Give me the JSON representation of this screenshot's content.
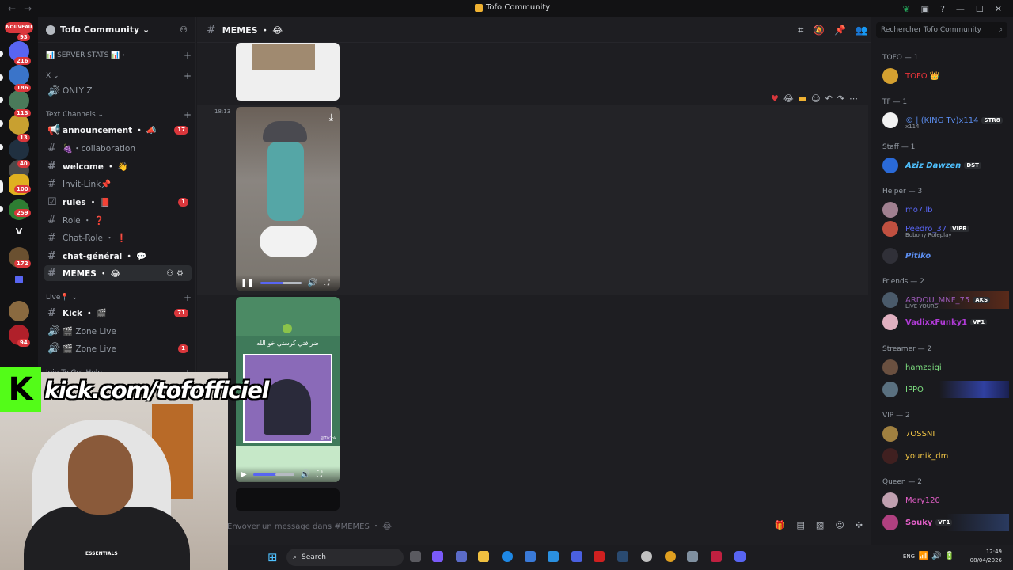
{
  "window": {
    "title": "Tofo Community",
    "back": "←",
    "forward": "→"
  },
  "guilds": {
    "new_label": "NOUVEAU",
    "badges": [
      "93",
      "216",
      "186",
      "113",
      "13",
      "40",
      "100",
      "259",
      "V",
      "172",
      "94"
    ]
  },
  "server": {
    "name": "Tofo Community ⌄"
  },
  "channels": {
    "categories": [
      {
        "label": "📊 SERVER STATS 📊 ›"
      },
      {
        "label": "X ⌄"
      },
      {
        "label": "Text Channels ⌄"
      },
      {
        "label": "Live📍 ⌄"
      },
      {
        "label": "Join To Get Help ⌄"
      }
    ],
    "only_z": "ONLY Z",
    "items": [
      {
        "name": "announcement ・ 📣",
        "badge": "17"
      },
      {
        "name": "🍇・collaboration",
        "badge": ""
      },
      {
        "name": "welcome ・ 👋",
        "badge": ""
      },
      {
        "name": "Invit-Link📌",
        "badge": ""
      },
      {
        "name": "rules ・ 📕",
        "badge": "1"
      },
      {
        "name": "Role ・ ❓",
        "badge": ""
      },
      {
        "name": "Chat-Role ・ ❗",
        "badge": ""
      },
      {
        "name": "chat-général ・ 💬",
        "badge": ""
      },
      {
        "name": "MEMES ・ 😂",
        "badge": ""
      },
      {
        "name": "Kick ・ 🎬",
        "badge": "71"
      },
      {
        "name": "🎬 Zone Live",
        "badge": ""
      },
      {
        "name": "🎬 Zone Live",
        "badge": "1"
      }
    ]
  },
  "channel_header": {
    "name": "MEMES ・ 😂"
  },
  "messages": {
    "timestamp": "18:13",
    "video_caption": "ضرافتي كرستي خو الله",
    "tiktok_user": "@TikTok"
  },
  "composer": {
    "placeholder": "Envoyer un message dans #MEMES ・ 😂"
  },
  "members_search": {
    "placeholder": "Rechercher Tofo Community"
  },
  "members": [
    {
      "category": "TOFO — 1",
      "users": [
        {
          "name": "TOFO 👑",
          "color": "#e8343a",
          "tag": "",
          "sub": ""
        }
      ]
    },
    {
      "category": "TF — 1",
      "users": [
        {
          "name": "© | (KING Tv)x114",
          "color": "#5b8def",
          "tag": "STR8",
          "sub": "x114"
        }
      ]
    },
    {
      "category": "Staff — 1",
      "users": [
        {
          "name": "Aziz Dawzen",
          "color": "#4fc1ff",
          "tag": "DST",
          "sub": ""
        }
      ]
    },
    {
      "category": "Helper — 3",
      "users": [
        {
          "name": "mo7.lb",
          "color": "#5865f2",
          "tag": "",
          "sub": ""
        },
        {
          "name": "Peedro_37",
          "color": "#5865f2",
          "tag": "VIPR",
          "sub": "Bobony Roleplay"
        },
        {
          "name": "Pitiko",
          "color": "#5b8def",
          "tag": "",
          "sub": ""
        }
      ]
    },
    {
      "category": "Friends — 2",
      "users": [
        {
          "name": "ARDOU_MNF_75",
          "color": "#9b59b6",
          "tag": "AKS",
          "sub": "LIVE YOURS"
        },
        {
          "name": "VadixxFunky1",
          "color": "#b13bd8",
          "tag": "VF1",
          "sub": ""
        }
      ]
    },
    {
      "category": "Streamer — 2",
      "users": [
        {
          "name": "hamzgigi",
          "color": "#7ee081",
          "tag": "",
          "sub": ""
        },
        {
          "name": "IPPO",
          "color": "#7ee081",
          "tag": "",
          "sub": ""
        }
      ]
    },
    {
      "category": "VIP — 2",
      "users": [
        {
          "name": "7OSSNI",
          "color": "#f0c445",
          "tag": "",
          "sub": ""
        },
        {
          "name": "younik_dm",
          "color": "#f0c445",
          "tag": "",
          "sub": ""
        }
      ]
    },
    {
      "category": "Queen — 2",
      "users": [
        {
          "name": "Mery120",
          "color": "#e25fc7",
          "tag": "",
          "sub": ""
        },
        {
          "name": "Souky",
          "color": "#e25fc7",
          "tag": "VF1",
          "sub": ""
        }
      ]
    }
  ],
  "overlay": {
    "kick_letter": "K",
    "kick_url": "kick.com/tofofficiel",
    "hoodie": "ESSENTIALS"
  },
  "taskbar": {
    "search_label": "Search",
    "lang": "ENG",
    "time": "12:49",
    "date": "08/04/2026"
  }
}
